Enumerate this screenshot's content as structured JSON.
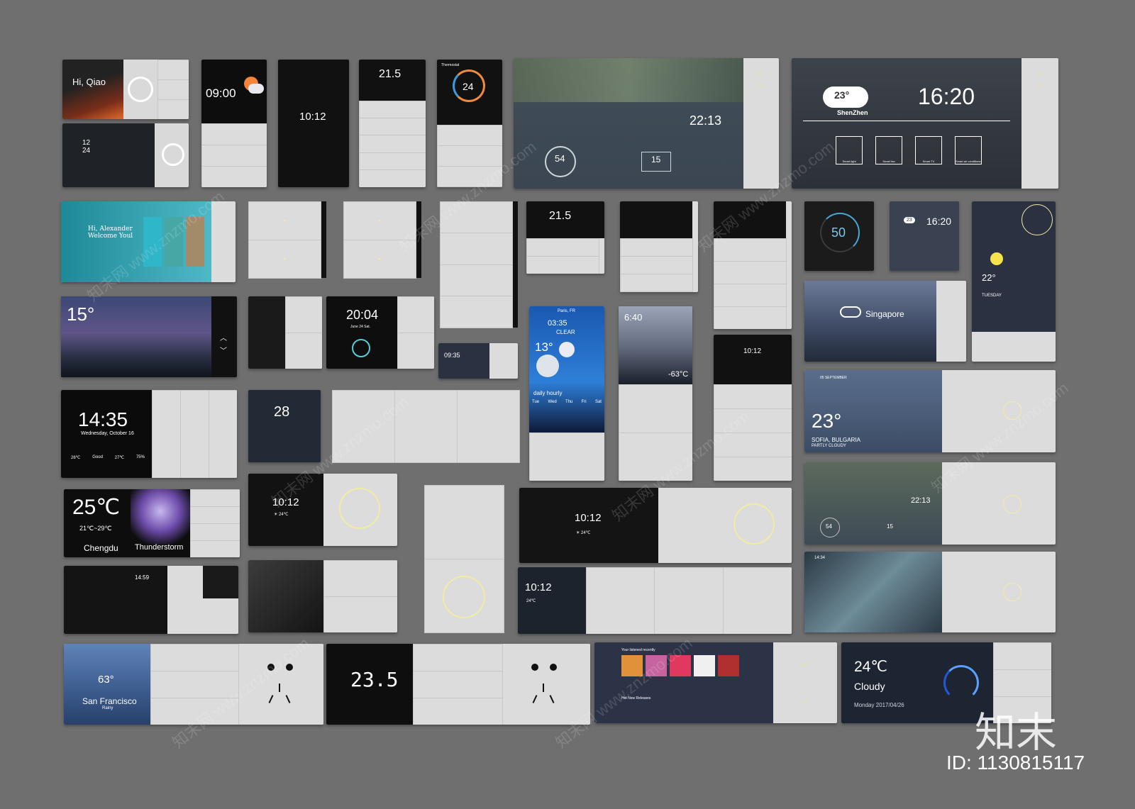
{
  "greeting": "Hi, Qiao",
  "row1": {
    "clock_a": "09:00",
    "clock_b": "10:12",
    "temp_a": "21.5",
    "thermo_title": "Thermostat",
    "thermo_val": "24",
    "big_clock": "22:13",
    "big_val": "54",
    "big_val2": "15",
    "weather_temp": "23°",
    "weather_city": "ShenZhen",
    "weather_time": "16:20",
    "devices": [
      "Smart light",
      "Smart fan",
      "Smart TV",
      "Smart air conditioner"
    ]
  },
  "row2": {
    "welcome": "Hi, Alexander\nWelcome Youl",
    "temp": "21.5",
    "gauge": "50",
    "mini_time": "16:20",
    "mini_temp": "23",
    "taipei_temp": "22°",
    "taipei_day": "TUESDAY"
  },
  "row3": {
    "storm_temp": "15°",
    "clock_2004": "20:04",
    "clock_2004_date": "June 24  Sat.",
    "paris_city": "Paris, FR",
    "paris_time": "03:35",
    "paris_cond": "CLEAR",
    "paris_temp": "13°",
    "paris_hourly": "daily  hourly",
    "paris_days": [
      "Tue",
      "Wed",
      "Thu",
      "Fri",
      "Sat"
    ],
    "night_time": "6:40",
    "night_temp": "-63°C",
    "singapore": "Singapore",
    "clock_1012": "10:12",
    "clock_0935": "09:35"
  },
  "row4": {
    "clock": "14:35",
    "date": "Wednesday, October 16",
    "stats": [
      "26℃",
      "Good",
      "27℃",
      "75%"
    ],
    "ac_val": "28",
    "sofia_temp": "23°",
    "sofia_city": "SOFIA, BULGARIA",
    "sofia_cond": "PARTLY CLOUDY",
    "sofia_date": "05 SEPTEMBER"
  },
  "row5": {
    "temp": "25℃",
    "range": "21℃~29℃",
    "city": "Chengdu",
    "cond": "Thunderstorm",
    "clock_a": "10:12",
    "clock_a_sub": "☀ 24℃",
    "clock_b": "10:12",
    "clock_b_sub": "☀ 24℃",
    "clock_c": "22:13",
    "val": "54",
    "val2": "15"
  },
  "row6": {
    "clock": "14:59",
    "clock2": "10:12",
    "clock2_sub": "24℃",
    "time_small": "14:34"
  },
  "row7": {
    "sf_temp": "63°",
    "sf_city": "San Francisco",
    "sf_cond": "Rainy",
    "thermo": "23.5",
    "music_title": "Your listened recently",
    "music_sub": "Hot New Releases",
    "cloudy_temp": "24℃",
    "cloudy_cond": "Cloudy",
    "cloudy_date": "Monday   2017/04/26"
  },
  "brand": "知末",
  "image_id": "ID: 1130815117",
  "watermark": "知末网 www.znzmo.com"
}
